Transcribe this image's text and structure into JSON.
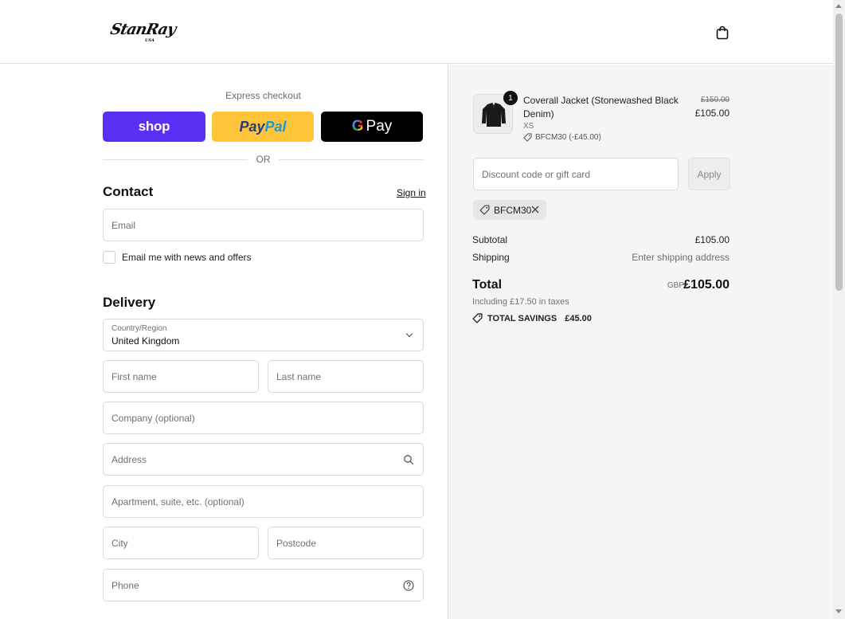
{
  "header": {
    "logo_text": "StanRay",
    "logo_sub": "USA"
  },
  "express": {
    "label": "Express checkout",
    "shop_label": "shop",
    "paypal_part1": "Pay",
    "paypal_part2": "Pal",
    "gpay_g": "G",
    "gpay_label": "Pay",
    "or_label": "OR"
  },
  "contact": {
    "title": "Contact",
    "sign_in": "Sign in",
    "email_placeholder": "Email",
    "newsletter_label": "Email me with news and offers"
  },
  "delivery": {
    "title": "Delivery",
    "country_label": "Country/Region",
    "country_value": "United Kingdom",
    "first_name": "First name",
    "last_name": "Last name",
    "company": "Company (optional)",
    "address": "Address",
    "apartment": "Apartment, suite, etc. (optional)",
    "city": "City",
    "postcode": "Postcode",
    "phone": "Phone"
  },
  "summary": {
    "item": {
      "quantity": "1",
      "title": "Coverall Jacket (Stonewashed Black Denim)",
      "variant": "XS",
      "discount": "BFCM30 (-£45.00)",
      "old_price": "£150.00",
      "price": "£105.00"
    },
    "discount_placeholder": "Discount code or gift card",
    "apply_label": "Apply",
    "applied_code": "BFCM30",
    "subtotal_label": "Subtotal",
    "subtotal_value": "£105.00",
    "shipping_label": "Shipping",
    "shipping_value": "Enter shipping address",
    "total_label": "Total",
    "currency": "GBP",
    "total_value": "£105.00",
    "tax_note": "Including £17.50 in taxes",
    "savings_label": "TOTAL SAVINGS",
    "savings_value": "£45.00"
  },
  "colors": {
    "shop": "#5a31f4",
    "paypal": "#ffc439",
    "gpay": "#000000",
    "panel_bg": "#f5f5f5"
  }
}
